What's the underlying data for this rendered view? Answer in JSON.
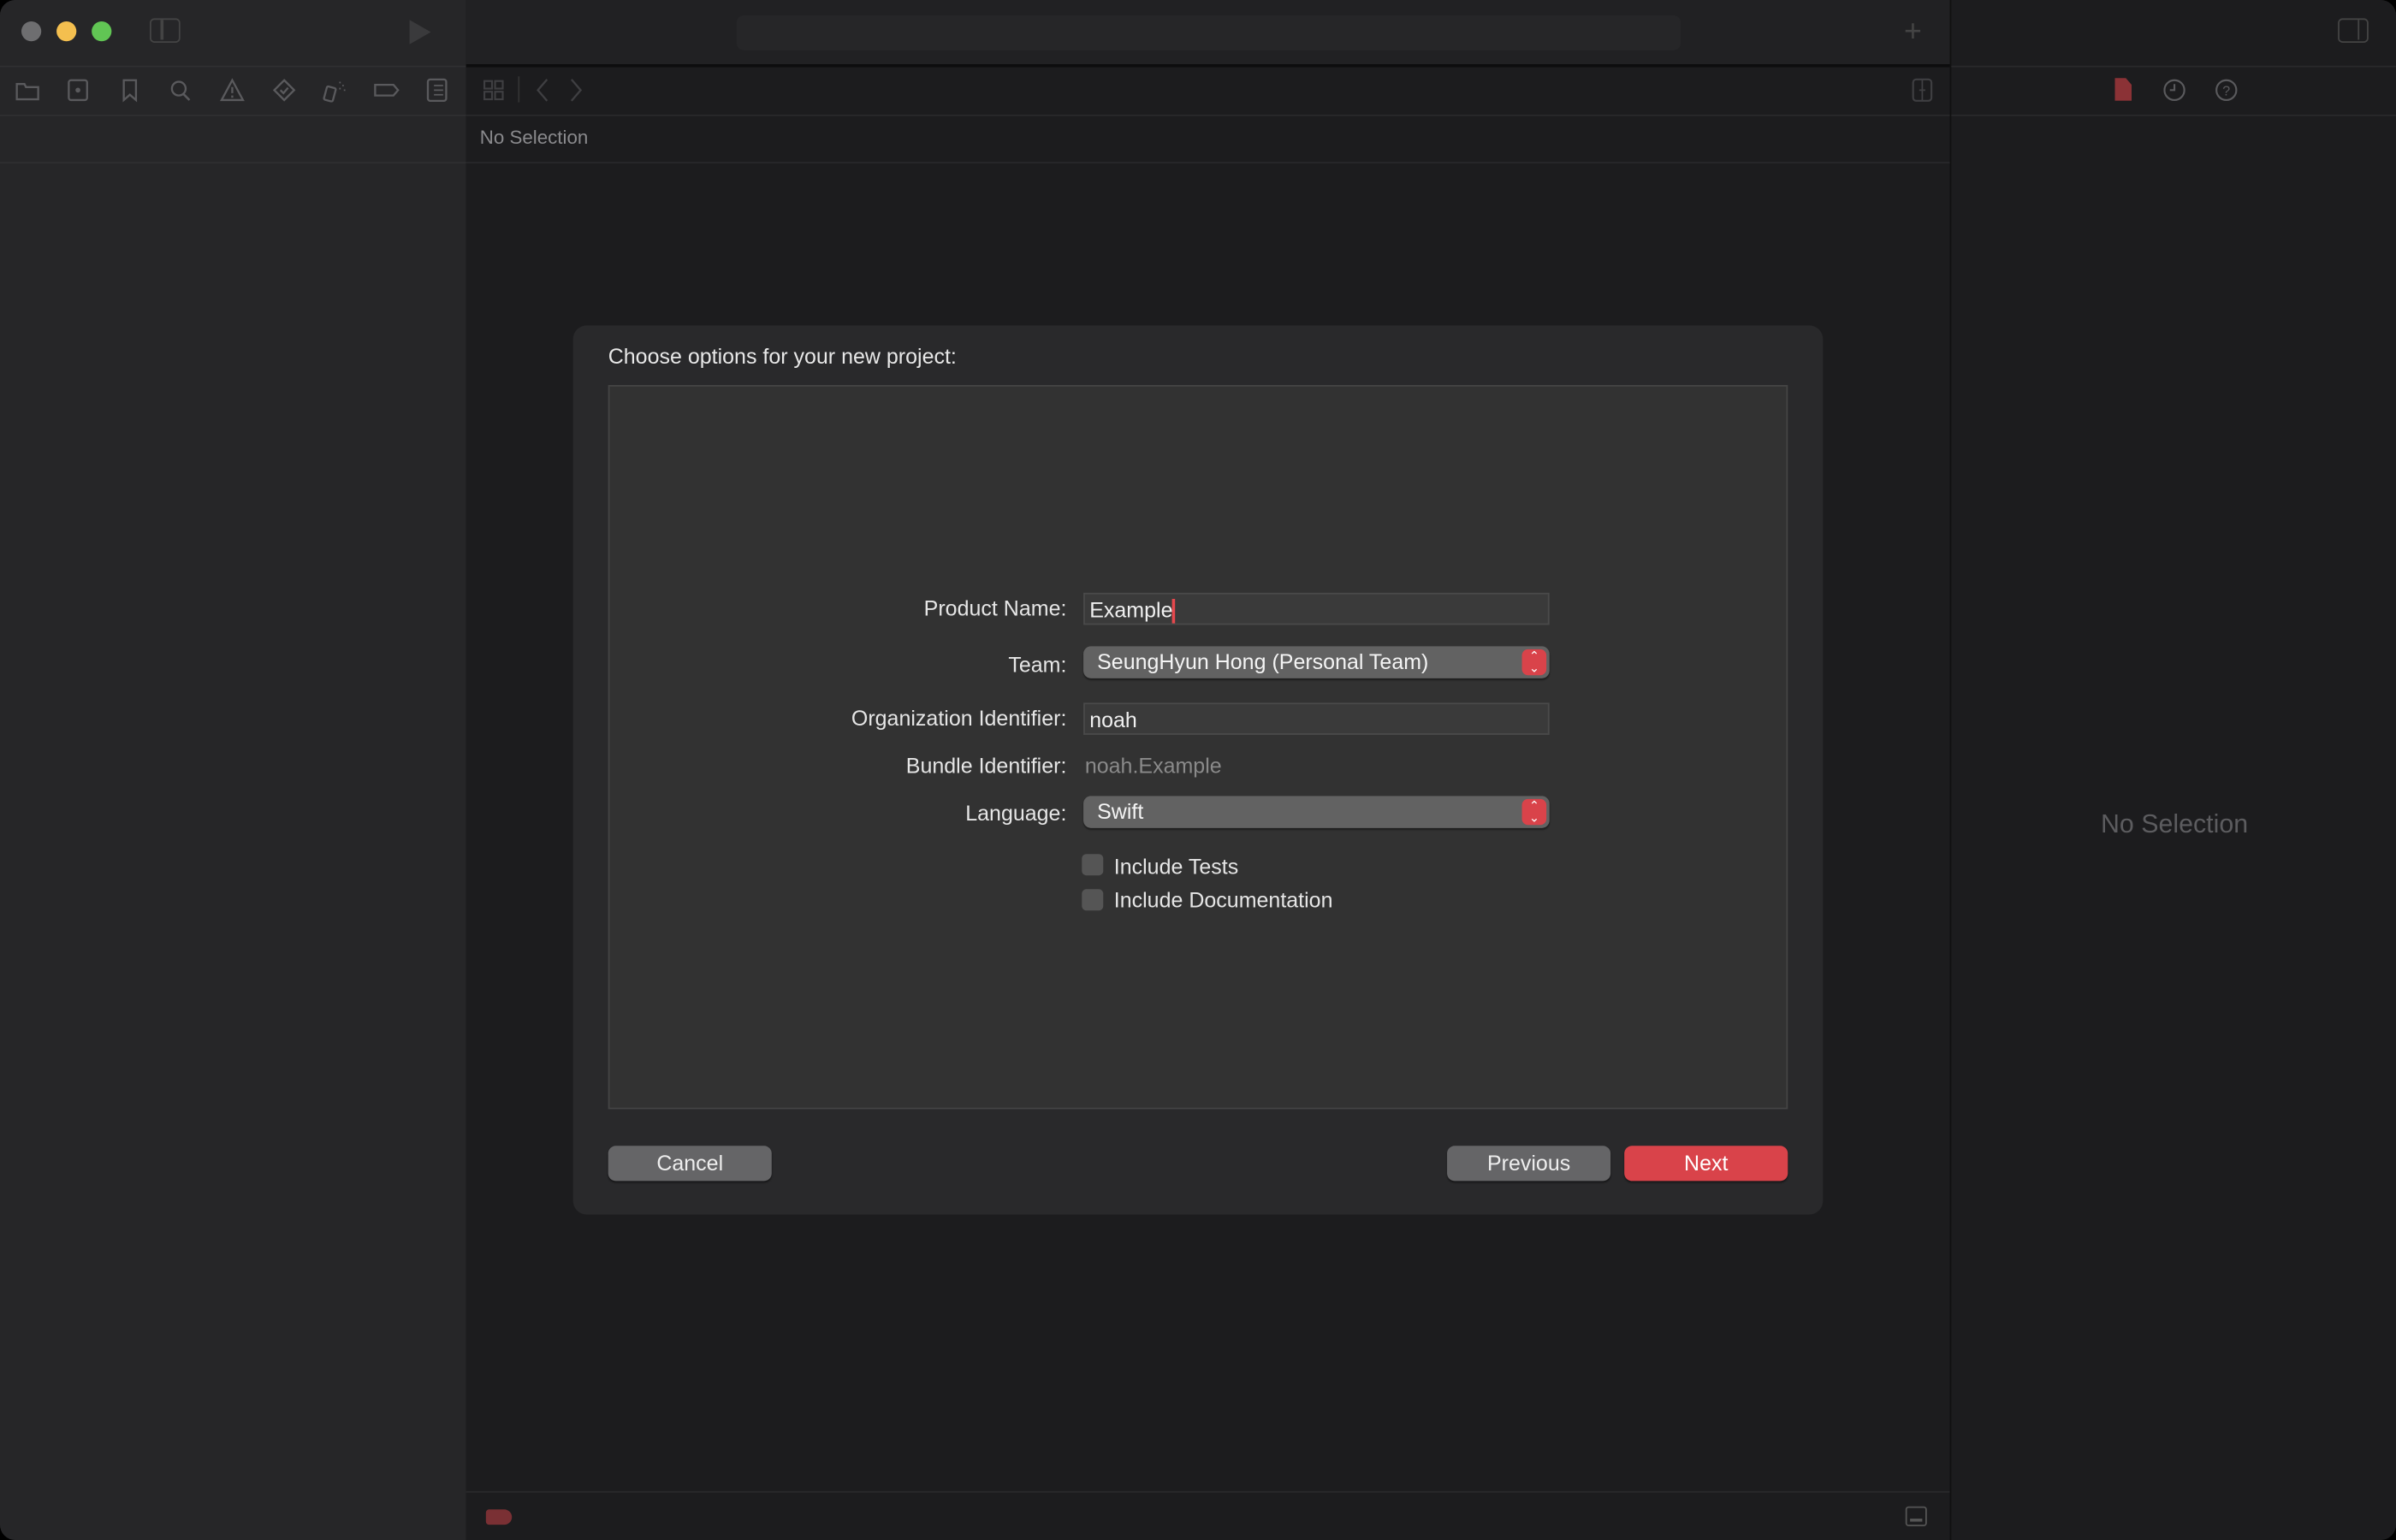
{
  "window": {
    "traffic_lights": {
      "close": "#6e6e70",
      "minimize": "#f4bf4f",
      "zoom": "#61c554"
    }
  },
  "navigator": {
    "icons": [
      "folder-icon",
      "source-control-icon",
      "bookmark-icon",
      "search-icon",
      "warning-icon",
      "test-icon",
      "debug-spray-icon",
      "breakpoint-icon",
      "report-icon"
    ]
  },
  "editor": {
    "no_selection": "No Selection"
  },
  "inspector": {
    "icons": [
      "file-icon",
      "history-icon",
      "help-icon"
    ],
    "no_selection": "No Selection"
  },
  "dialog": {
    "title": "Choose options for your new project:",
    "fields": {
      "product_name": {
        "label": "Product Name:",
        "value": "Example"
      },
      "team": {
        "label": "Team:",
        "value": "SeungHyun Hong (Personal Team)"
      },
      "org_identifier": {
        "label": "Organization Identifier:",
        "value": "noah"
      },
      "bundle_identifier": {
        "label": "Bundle Identifier:",
        "value": "noah.Example"
      },
      "language": {
        "label": "Language:",
        "value": "Swift"
      }
    },
    "checkboxes": {
      "include_tests": {
        "label": "Include Tests",
        "checked": false
      },
      "include_documentation": {
        "label": "Include Documentation",
        "checked": false
      }
    },
    "buttons": {
      "cancel": "Cancel",
      "previous": "Previous",
      "next": "Next"
    }
  },
  "colors": {
    "accent": "#d9434a"
  }
}
